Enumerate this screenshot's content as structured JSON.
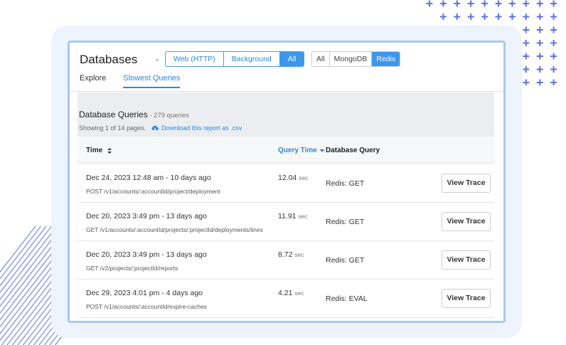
{
  "header": {
    "title": "Databases",
    "separator": "-"
  },
  "source_filter": {
    "options": [
      {
        "label": "Web (HTTP)",
        "active": false
      },
      {
        "label": "Background",
        "active": false
      },
      {
        "label": "All",
        "active": true
      }
    ]
  },
  "db_filter": {
    "options": [
      {
        "label": "All",
        "active": false
      },
      {
        "label": "MongoDB",
        "active": false
      },
      {
        "label": "Redis",
        "active": true
      }
    ]
  },
  "tabs": [
    {
      "label": "Explore",
      "active": false
    },
    {
      "label": "Slowest Queries",
      "active": true
    }
  ],
  "summary": {
    "heading": "Database Queries",
    "count_text": " - 279 queries",
    "showing": "Showing 1 of 14 pages.",
    "download_label": "Download this report as .csv"
  },
  "table": {
    "columns": {
      "time": "Time",
      "query_time": "Query Time",
      "database_query": "Database Query"
    },
    "sec_unit": "sec",
    "view_trace_label": "View Trace",
    "rows": [
      {
        "date": "Dec 24, 2023 12:48 am - 10 days ago",
        "path": "POST /v1/accounts/:accountId/project/deployment",
        "query_time": "12.04",
        "query": "Redis: GET"
      },
      {
        "date": "Dec 20, 2023 3:49 pm - 13 days ago",
        "path": "GET /v1/accounts/:accountId/projects/:projectId/deployments/lines",
        "query_time": "11.91",
        "query": "Redis: GET"
      },
      {
        "date": "Dec 20, 2023 3:49 pm - 13 days ago",
        "path": "GET /v2/projects/:projectId/reports",
        "query_time": "8.72",
        "query": "Redis: GET"
      },
      {
        "date": "Dec 29, 2023 4:01 pm - 4 days ago",
        "path": "POST /v1/accounts/:accountId/expire-caches",
        "query_time": "4.21",
        "query": "Redis: EVAL"
      }
    ]
  },
  "colors": {
    "accent": "#3d97ec",
    "link": "#2f86db",
    "panel_border": "#a9c8f0",
    "decoration": "#5b72e8"
  },
  "icons": {
    "sort": "sort-icon",
    "sort_desc": "sort-desc-icon",
    "download": "cloud-download-icon"
  }
}
